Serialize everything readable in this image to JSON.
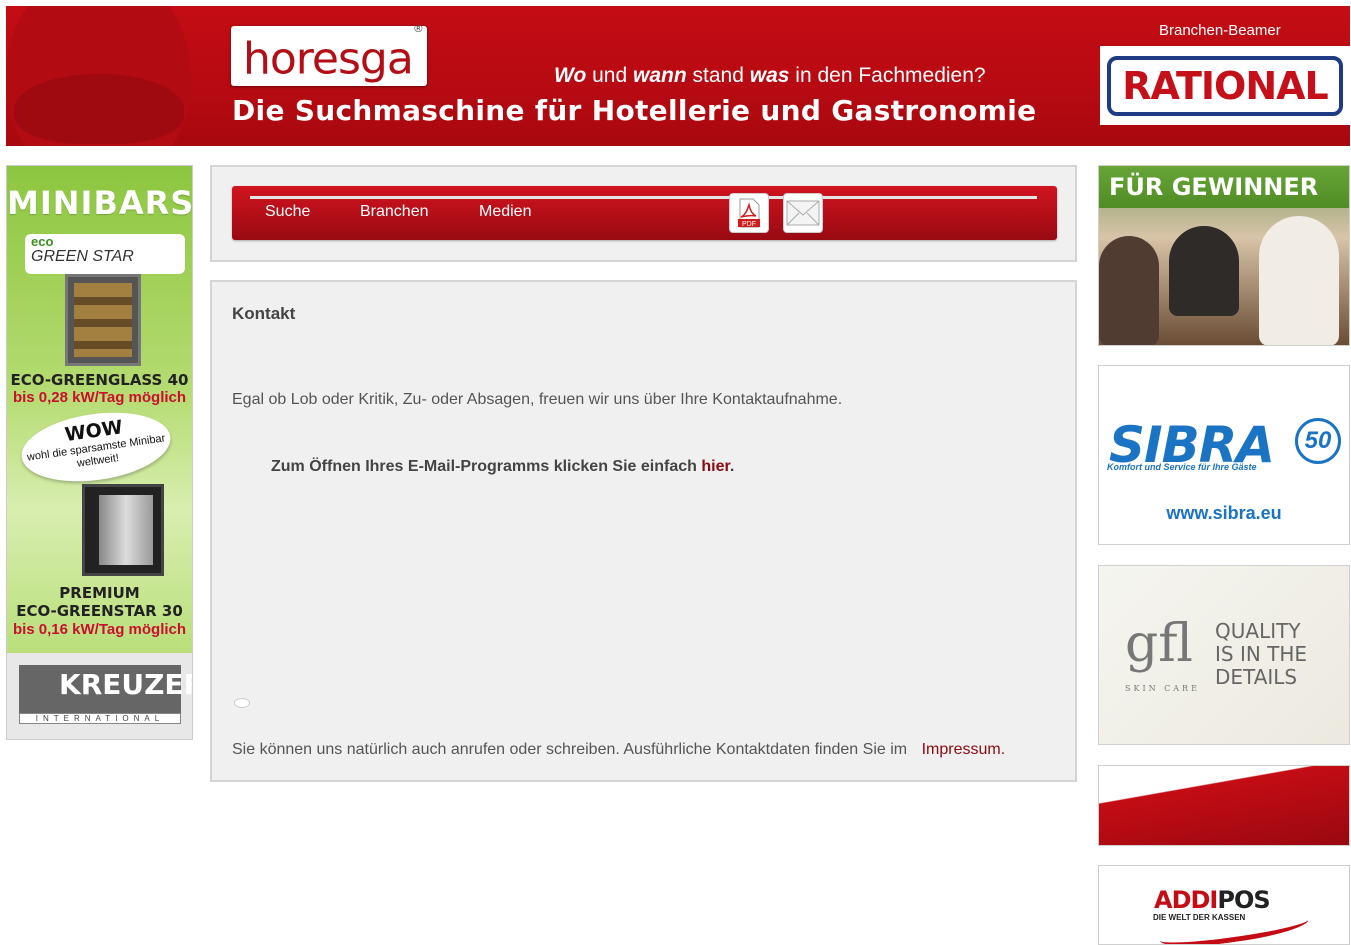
{
  "header": {
    "logo": "horesga",
    "logo_mark": "®",
    "tagline_wo": "Wo",
    "tagline_und": "und",
    "tagline_wann": "wann",
    "tagline_stand": "stand",
    "tagline_was": "was",
    "tagline_rest": "in den Fachmedien?",
    "headline": "Die Suchmaschine für Hotellerie und Gastronomie",
    "beamer_label": "Branchen-Beamer",
    "sponsor": "RATIONAL"
  },
  "left_ad": {
    "title": "MINIBARS",
    "brand_eco": "eco",
    "brand": "GREEN STAR",
    "model1": "ECO-GREENGLASS 40",
    "model1_note": "bis 0,28 kW/Tag möglich",
    "wow": "WOW",
    "wow_text": "wohl die sparsamste Minibar weltweit!",
    "model2_line1": "PREMIUM",
    "model2_line2": "ECO-GREENSTAR 30",
    "model2_note": "bis 0,16 kW/Tag möglich",
    "maker": "KREUZER",
    "maker_sub": "INTERNATIONAL"
  },
  "nav": {
    "items": [
      "Suche",
      "Branchen",
      "Medien"
    ],
    "pdf_icon": "pdf-icon",
    "mail_icon": "mail-icon"
  },
  "content": {
    "title": "Kontakt",
    "intro": "Egal ob Lob oder Kritik, Zu- oder Absagen, freuen wir uns über Ihre Kontaktaufnahme.",
    "mail_text": "Zum Öffnen Ihres E-Mail-Programms klicken Sie einfach",
    "mail_link": "hier",
    "mail_end": ".",
    "footer_text": "Sie können uns natürlich auch anrufen oder schreiben. Ausführliche Kontaktdaten finden Sie im",
    "footer_link": "Impressum."
  },
  "right_ads": {
    "gewinner_title": "FÜR GEWINNER",
    "sibra_title": "SIBRA",
    "sibra_badge": "50",
    "sibra_slogan": "Komfort und Service für Ihre Gäste",
    "sibra_url": "www.sibra.eu",
    "gfl_logo": "gfl",
    "gfl_sub": "SKIN CARE",
    "gfl_line1": "QUALITY",
    "gfl_line2": "IS IN THE",
    "gfl_line3": "DETAILS",
    "addipos_a": "ADDI",
    "addipos_b": "POS",
    "addipos_sub": "DIE WELT DER KASSEN"
  },
  "colors": {
    "brand_red": "#c40c14",
    "link_red": "#8b0a0f",
    "panel_bg": "#f0f0f0"
  }
}
